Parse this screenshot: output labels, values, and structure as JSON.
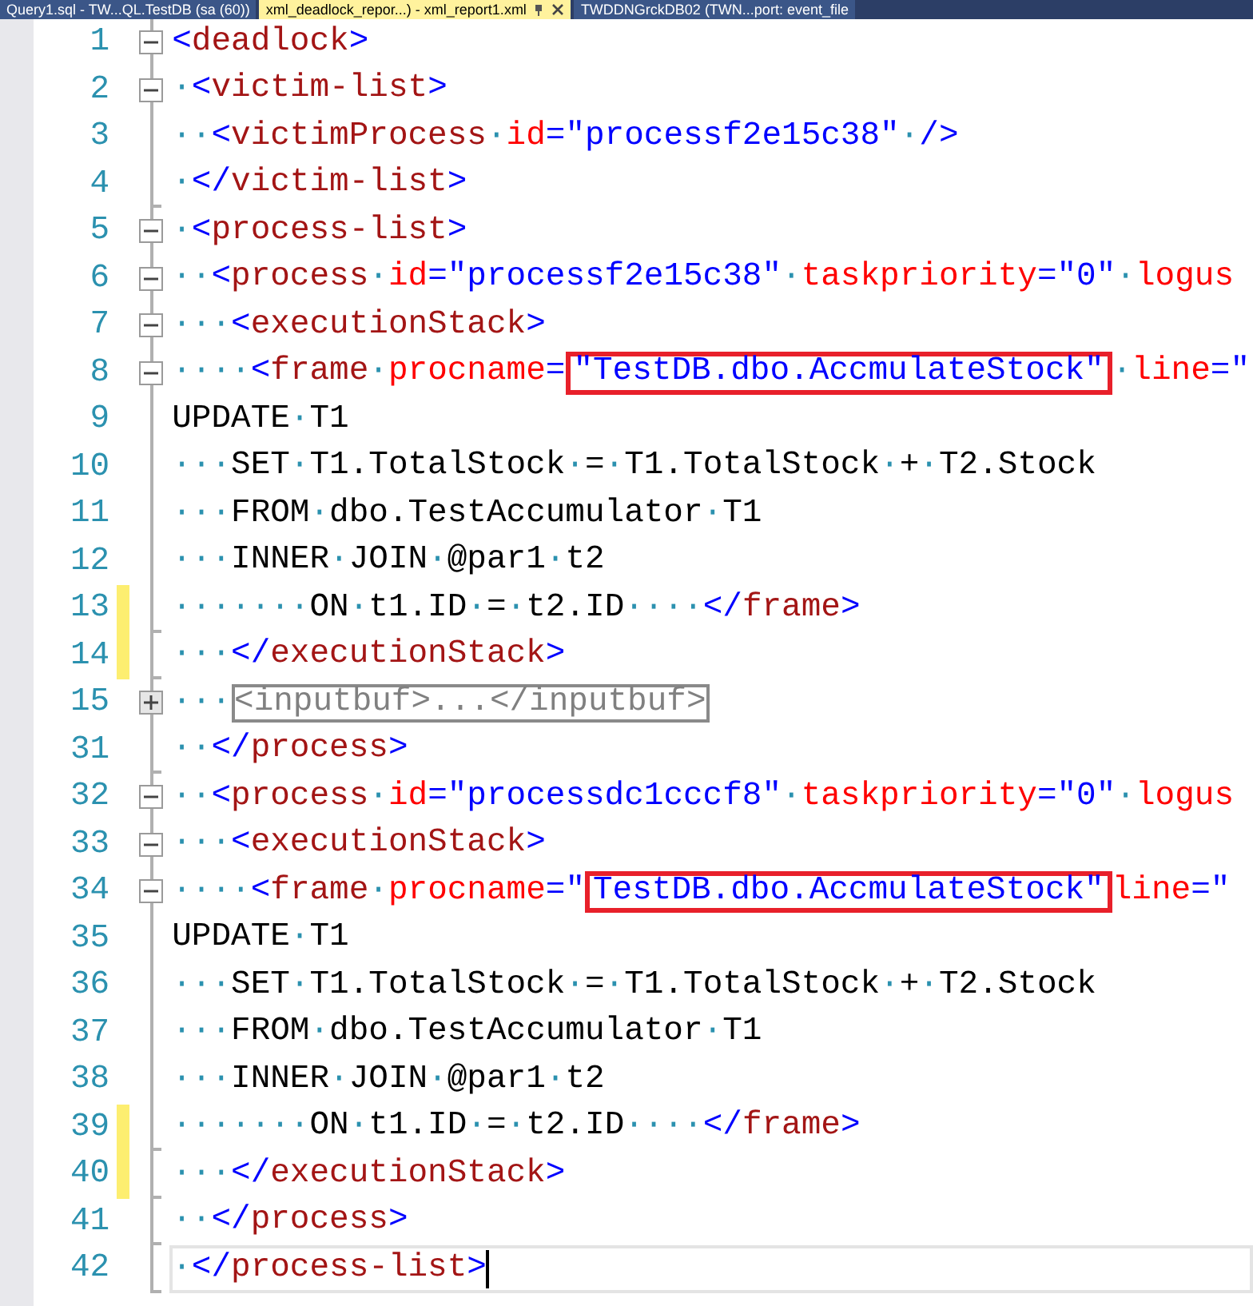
{
  "tabs": [
    {
      "title": "Query1.sql - TW...QL.TestDB (sa (60))",
      "selected": false
    },
    {
      "title": "xml_deadlock_repor...) - xml_report1.xml",
      "selected": true
    },
    {
      "title": "TWDDNGrckDB02 (TWN...port: event_file",
      "selected": false
    }
  ],
  "lines": [
    {
      "number": "1",
      "kind": "open",
      "changed": false,
      "current": false,
      "tokens": [
        {
          "kind": "punct",
          "t": "<"
        },
        {
          "kind": "tag",
          "t": "deadlock"
        },
        {
          "kind": "punct",
          "t": ">"
        }
      ]
    },
    {
      "number": "2",
      "kind": "open",
      "changed": false,
      "current": false,
      "tokens": [
        {
          "kind": "space",
          "t": "·"
        },
        {
          "kind": "punct",
          "t": "<"
        },
        {
          "kind": "tag",
          "t": "victim-list"
        },
        {
          "kind": "punct",
          "t": ">"
        }
      ]
    },
    {
      "number": "3",
      "kind": "inner",
      "changed": false,
      "current": false,
      "tokens": [
        {
          "kind": "space",
          "t": "··"
        },
        {
          "kind": "punct",
          "t": "<"
        },
        {
          "kind": "tag",
          "t": "victimProcess"
        },
        {
          "kind": "space",
          "t": "·"
        },
        {
          "kind": "attr",
          "t": "id"
        },
        {
          "kind": "punct",
          "t": "=\"processf2e15c38\""
        },
        {
          "kind": "space",
          "t": "·"
        },
        {
          "kind": "punct",
          "t": "/>"
        }
      ]
    },
    {
      "number": "4",
      "kind": "close",
      "changed": false,
      "current": false,
      "tokens": [
        {
          "kind": "space",
          "t": "·"
        },
        {
          "kind": "punct",
          "t": "</"
        },
        {
          "kind": "tag",
          "t": "victim-list"
        },
        {
          "kind": "punct",
          "t": ">"
        }
      ]
    },
    {
      "number": "5",
      "kind": "open",
      "changed": false,
      "current": false,
      "tokens": [
        {
          "kind": "space",
          "t": "·"
        },
        {
          "kind": "punct",
          "t": "<"
        },
        {
          "kind": "tag",
          "t": "process-list"
        },
        {
          "kind": "punct",
          "t": ">"
        }
      ]
    },
    {
      "number": "6",
      "kind": "open",
      "changed": false,
      "current": false,
      "tokens": [
        {
          "kind": "space",
          "t": "··"
        },
        {
          "kind": "punct",
          "t": "<"
        },
        {
          "kind": "tag",
          "t": "process"
        },
        {
          "kind": "space",
          "t": "·"
        },
        {
          "kind": "attr",
          "t": "id"
        },
        {
          "kind": "punct",
          "t": "=\"processf2e15c38\""
        },
        {
          "kind": "space",
          "t": "·"
        },
        {
          "kind": "attr",
          "t": "taskpriority"
        },
        {
          "kind": "punct",
          "t": "=\"0\""
        },
        {
          "kind": "space",
          "t": "·"
        },
        {
          "kind": "attr",
          "t": "logus"
        }
      ]
    },
    {
      "number": "7",
      "kind": "open",
      "changed": false,
      "current": false,
      "tokens": [
        {
          "kind": "space",
          "t": "···"
        },
        {
          "kind": "punct",
          "t": "<"
        },
        {
          "kind": "tag",
          "t": "executionStack"
        },
        {
          "kind": "punct",
          "t": ">"
        }
      ]
    },
    {
      "number": "8",
      "kind": "open",
      "changed": false,
      "current": false,
      "tokens": [
        {
          "kind": "space",
          "t": "····"
        },
        {
          "kind": "punct",
          "t": "<"
        },
        {
          "kind": "tag",
          "t": "frame"
        },
        {
          "kind": "space",
          "t": "·"
        },
        {
          "kind": "attr",
          "t": "procname"
        },
        {
          "kind": "punct",
          "t": "="
        },
        {
          "kind": "boxed",
          "t": "\"TestDB.dbo.AccmulateStock\""
        },
        {
          "kind": "space",
          "t": "·"
        },
        {
          "kind": "attr",
          "t": "line"
        },
        {
          "kind": "punct",
          "t": "=\""
        }
      ]
    },
    {
      "number": "9",
      "kind": "inner",
      "changed": false,
      "current": false,
      "tokens": [
        {
          "kind": "text",
          "t": "UPDATE"
        },
        {
          "kind": "space",
          "t": "·"
        },
        {
          "kind": "text",
          "t": "T1"
        }
      ]
    },
    {
      "number": "10",
      "kind": "inner",
      "changed": false,
      "current": false,
      "tokens": [
        {
          "kind": "space",
          "t": "···"
        },
        {
          "kind": "text",
          "t": "SET"
        },
        {
          "kind": "space",
          "t": "·"
        },
        {
          "kind": "text",
          "t": "T1.TotalStock"
        },
        {
          "kind": "space",
          "t": "·"
        },
        {
          "kind": "text",
          "t": "="
        },
        {
          "kind": "space",
          "t": "·"
        },
        {
          "kind": "text",
          "t": "T1.TotalStock"
        },
        {
          "kind": "space",
          "t": "·"
        },
        {
          "kind": "text",
          "t": "+"
        },
        {
          "kind": "space",
          "t": "·"
        },
        {
          "kind": "text",
          "t": "T2.Stock"
        }
      ]
    },
    {
      "number": "11",
      "kind": "inner",
      "changed": false,
      "current": false,
      "tokens": [
        {
          "kind": "space",
          "t": "···"
        },
        {
          "kind": "text",
          "t": "FROM"
        },
        {
          "kind": "space",
          "t": "·"
        },
        {
          "kind": "text",
          "t": "dbo.TestAccumulator"
        },
        {
          "kind": "space",
          "t": "·"
        },
        {
          "kind": "text",
          "t": "T1"
        }
      ]
    },
    {
      "number": "12",
      "kind": "inner",
      "changed": false,
      "current": false,
      "tokens": [
        {
          "kind": "space",
          "t": "···"
        },
        {
          "kind": "text",
          "t": "INNER"
        },
        {
          "kind": "space",
          "t": "·"
        },
        {
          "kind": "text",
          "t": "JOIN"
        },
        {
          "kind": "space",
          "t": "·"
        },
        {
          "kind": "text",
          "t": "@par1"
        },
        {
          "kind": "space",
          "t": "·"
        },
        {
          "kind": "text",
          "t": "t2"
        }
      ]
    },
    {
      "number": "13",
      "kind": "close",
      "changed": true,
      "current": false,
      "tokens": [
        {
          "kind": "space",
          "t": "·······"
        },
        {
          "kind": "text",
          "t": "ON"
        },
        {
          "kind": "space",
          "t": "·"
        },
        {
          "kind": "text",
          "t": "t1.ID"
        },
        {
          "kind": "space",
          "t": "·"
        },
        {
          "kind": "text",
          "t": "="
        },
        {
          "kind": "space",
          "t": "·"
        },
        {
          "kind": "text",
          "t": "t2.ID"
        },
        {
          "kind": "space",
          "t": "····"
        },
        {
          "kind": "punct",
          "t": "</"
        },
        {
          "kind": "tag",
          "t": "frame"
        },
        {
          "kind": "punct",
          "t": ">"
        }
      ]
    },
    {
      "number": "14",
      "kind": "close",
      "changed": true,
      "current": false,
      "tokens": [
        {
          "kind": "space",
          "t": "···"
        },
        {
          "kind": "punct",
          "t": "</"
        },
        {
          "kind": "tag",
          "t": "executionStack"
        },
        {
          "kind": "punct",
          "t": ">"
        }
      ]
    },
    {
      "number": "15",
      "kind": "folded",
      "changed": false,
      "current": false,
      "tokens": [
        {
          "kind": "space",
          "t": "···"
        },
        {
          "kind": "collapsed",
          "t": "<inputbuf>...</inputbuf>"
        }
      ]
    },
    {
      "number": "31",
      "kind": "close",
      "changed": false,
      "current": false,
      "tokens": [
        {
          "kind": "space",
          "t": "··"
        },
        {
          "kind": "punct",
          "t": "</"
        },
        {
          "kind": "tag",
          "t": "process"
        },
        {
          "kind": "punct",
          "t": ">"
        }
      ]
    },
    {
      "number": "32",
      "kind": "open",
      "changed": false,
      "current": false,
      "tokens": [
        {
          "kind": "space",
          "t": "··"
        },
        {
          "kind": "punct",
          "t": "<"
        },
        {
          "kind": "tag",
          "t": "process"
        },
        {
          "kind": "space",
          "t": "·"
        },
        {
          "kind": "attr",
          "t": "id"
        },
        {
          "kind": "punct",
          "t": "=\"processdc1cccf8\""
        },
        {
          "kind": "space",
          "t": "·"
        },
        {
          "kind": "attr",
          "t": "taskpriority"
        },
        {
          "kind": "punct",
          "t": "=\"0\""
        },
        {
          "kind": "space",
          "t": "·"
        },
        {
          "kind": "attr",
          "t": "logus"
        }
      ]
    },
    {
      "number": "33",
      "kind": "open",
      "changed": false,
      "current": false,
      "tokens": [
        {
          "kind": "space",
          "t": "···"
        },
        {
          "kind": "punct",
          "t": "<"
        },
        {
          "kind": "tag",
          "t": "executionStack"
        },
        {
          "kind": "punct",
          "t": ">"
        }
      ]
    },
    {
      "number": "34",
      "kind": "open",
      "changed": false,
      "current": false,
      "tokens": [
        {
          "kind": "space",
          "t": "····"
        },
        {
          "kind": "punct",
          "t": "<"
        },
        {
          "kind": "tag",
          "t": "frame"
        },
        {
          "kind": "space",
          "t": "·"
        },
        {
          "kind": "attr",
          "t": "procname"
        },
        {
          "kind": "punct",
          "t": "=\""
        },
        {
          "kind": "boxed",
          "t": "TestDB.dbo.AccmulateStock\""
        },
        {
          "kind": "attr",
          "t": "line"
        },
        {
          "kind": "punct",
          "t": "=\""
        }
      ]
    },
    {
      "number": "35",
      "kind": "inner",
      "changed": false,
      "current": false,
      "tokens": [
        {
          "kind": "text",
          "t": "UPDATE"
        },
        {
          "kind": "space",
          "t": "·"
        },
        {
          "kind": "text",
          "t": "T1"
        }
      ]
    },
    {
      "number": "36",
      "kind": "inner",
      "changed": false,
      "current": false,
      "tokens": [
        {
          "kind": "space",
          "t": "···"
        },
        {
          "kind": "text",
          "t": "SET"
        },
        {
          "kind": "space",
          "t": "·"
        },
        {
          "kind": "text",
          "t": "T1.TotalStock"
        },
        {
          "kind": "space",
          "t": "·"
        },
        {
          "kind": "text",
          "t": "="
        },
        {
          "kind": "space",
          "t": "·"
        },
        {
          "kind": "text",
          "t": "T1.TotalStock"
        },
        {
          "kind": "space",
          "t": "·"
        },
        {
          "kind": "text",
          "t": "+"
        },
        {
          "kind": "space",
          "t": "·"
        },
        {
          "kind": "text",
          "t": "T2.Stock"
        }
      ]
    },
    {
      "number": "37",
      "kind": "inner",
      "changed": false,
      "current": false,
      "tokens": [
        {
          "kind": "space",
          "t": "···"
        },
        {
          "kind": "text",
          "t": "FROM"
        },
        {
          "kind": "space",
          "t": "·"
        },
        {
          "kind": "text",
          "t": "dbo.TestAccumulator"
        },
        {
          "kind": "space",
          "t": "·"
        },
        {
          "kind": "text",
          "t": "T1"
        }
      ]
    },
    {
      "number": "38",
      "kind": "inner",
      "changed": false,
      "current": false,
      "tokens": [
        {
          "kind": "space",
          "t": "···"
        },
        {
          "kind": "text",
          "t": "INNER"
        },
        {
          "kind": "space",
          "t": "·"
        },
        {
          "kind": "text",
          "t": "JOIN"
        },
        {
          "kind": "space",
          "t": "·"
        },
        {
          "kind": "text",
          "t": "@par1"
        },
        {
          "kind": "space",
          "t": "·"
        },
        {
          "kind": "text",
          "t": "t2"
        }
      ]
    },
    {
      "number": "39",
      "kind": "close",
      "changed": true,
      "current": false,
      "tokens": [
        {
          "kind": "space",
          "t": "·······"
        },
        {
          "kind": "text",
          "t": "ON"
        },
        {
          "kind": "space",
          "t": "·"
        },
        {
          "kind": "text",
          "t": "t1.ID"
        },
        {
          "kind": "space",
          "t": "·"
        },
        {
          "kind": "text",
          "t": "="
        },
        {
          "kind": "space",
          "t": "·"
        },
        {
          "kind": "text",
          "t": "t2.ID"
        },
        {
          "kind": "space",
          "t": "····"
        },
        {
          "kind": "punct",
          "t": "</"
        },
        {
          "kind": "tag",
          "t": "frame"
        },
        {
          "kind": "punct",
          "t": ">"
        }
      ]
    },
    {
      "number": "40",
      "kind": "close",
      "changed": true,
      "current": false,
      "tokens": [
        {
          "kind": "space",
          "t": "···"
        },
        {
          "kind": "punct",
          "t": "</"
        },
        {
          "kind": "tag",
          "t": "executionStack"
        },
        {
          "kind": "punct",
          "t": ">"
        }
      ]
    },
    {
      "number": "41",
      "kind": "close",
      "changed": false,
      "current": false,
      "tokens": [
        {
          "kind": "space",
          "t": "··"
        },
        {
          "kind": "punct",
          "t": "</"
        },
        {
          "kind": "tag",
          "t": "process"
        },
        {
          "kind": "punct",
          "t": ">"
        }
      ]
    },
    {
      "number": "42",
      "kind": "close",
      "changed": false,
      "current": true,
      "tokens": [
        {
          "kind": "space",
          "t": "·"
        },
        {
          "kind": "punct",
          "t": "</"
        },
        {
          "kind": "tag",
          "t": "process-list"
        },
        {
          "kind": "punct",
          "t": ">"
        }
      ]
    }
  ]
}
